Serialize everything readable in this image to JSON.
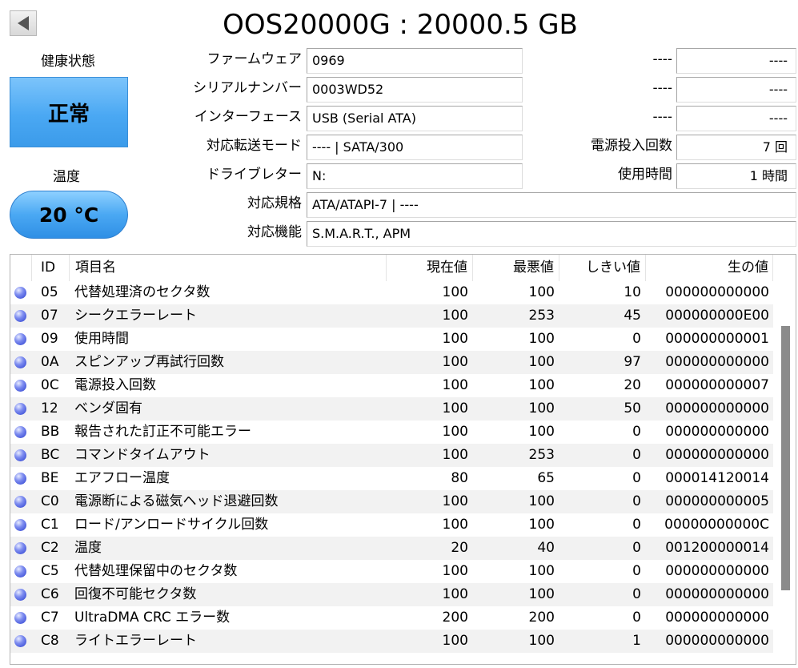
{
  "header": {
    "title": "OOS20000G : 20000.5 GB"
  },
  "health": {
    "label": "健康状態",
    "status": "正常",
    "color": "#4aa8f3"
  },
  "temperature": {
    "label": "温度",
    "value": "20 °C"
  },
  "info": {
    "firmware": {
      "label": "ファームウェア",
      "value": "0969"
    },
    "serial": {
      "label": "シリアルナンバー",
      "value": "0003WD52"
    },
    "interface": {
      "label": "インターフェース",
      "value": "USB (Serial ATA)"
    },
    "transfer_mode": {
      "label": "対応転送モード",
      "value": "---- | SATA/300"
    },
    "drive_letter": {
      "label": "ドライブレター",
      "value": "N:"
    },
    "standard": {
      "label": "対応規格",
      "value": "ATA/ATAPI-7 | ----"
    },
    "features": {
      "label": "対応機能",
      "value": "S.M.A.R.T., APM"
    }
  },
  "extra": {
    "r1": {
      "label": "----",
      "value": "----"
    },
    "r2": {
      "label": "----",
      "value": "----"
    },
    "r3": {
      "label": "----",
      "value": "----"
    },
    "power_on_count": {
      "label": "電源投入回数",
      "value": "7 回"
    },
    "power_on_hours": {
      "label": "使用時間",
      "value": "1 時間"
    }
  },
  "table": {
    "headers": {
      "id": "ID",
      "name": "項目名",
      "current": "現在値",
      "worst": "最悪値",
      "threshold": "しきい値",
      "raw": "生の値"
    },
    "rows": [
      {
        "id": "05",
        "name": "代替処理済のセクタ数",
        "current": "100",
        "worst": "100",
        "threshold": "10",
        "raw": "000000000000"
      },
      {
        "id": "07",
        "name": "シークエラーレート",
        "current": "100",
        "worst": "253",
        "threshold": "45",
        "raw": "000000000E00"
      },
      {
        "id": "09",
        "name": "使用時間",
        "current": "100",
        "worst": "100",
        "threshold": "0",
        "raw": "000000000001"
      },
      {
        "id": "0A",
        "name": "スピンアップ再試行回数",
        "current": "100",
        "worst": "100",
        "threshold": "97",
        "raw": "000000000000"
      },
      {
        "id": "0C",
        "name": "電源投入回数",
        "current": "100",
        "worst": "100",
        "threshold": "20",
        "raw": "000000000007"
      },
      {
        "id": "12",
        "name": "ベンダ固有",
        "current": "100",
        "worst": "100",
        "threshold": "50",
        "raw": "000000000000"
      },
      {
        "id": "BB",
        "name": "報告された訂正不可能エラー",
        "current": "100",
        "worst": "100",
        "threshold": "0",
        "raw": "000000000000"
      },
      {
        "id": "BC",
        "name": "コマンドタイムアウト",
        "current": "100",
        "worst": "253",
        "threshold": "0",
        "raw": "000000000000"
      },
      {
        "id": "BE",
        "name": "エアフロー温度",
        "current": "80",
        "worst": "65",
        "threshold": "0",
        "raw": "000014120014"
      },
      {
        "id": "C0",
        "name": "電源断による磁気ヘッド退避回数",
        "current": "100",
        "worst": "100",
        "threshold": "0",
        "raw": "000000000005"
      },
      {
        "id": "C1",
        "name": "ロード/アンロードサイクル回数",
        "current": "100",
        "worst": "100",
        "threshold": "0",
        "raw": "00000000000C"
      },
      {
        "id": "C2",
        "name": "温度",
        "current": "20",
        "worst": "40",
        "threshold": "0",
        "raw": "001200000014"
      },
      {
        "id": "C5",
        "name": "代替処理保留中のセクタ数",
        "current": "100",
        "worst": "100",
        "threshold": "0",
        "raw": "000000000000"
      },
      {
        "id": "C6",
        "name": "回復不可能セクタ数",
        "current": "100",
        "worst": "100",
        "threshold": "0",
        "raw": "000000000000"
      },
      {
        "id": "C7",
        "name": "UltraDMA CRC エラー数",
        "current": "200",
        "worst": "200",
        "threshold": "0",
        "raw": "000000000000"
      },
      {
        "id": "C8",
        "name": "ライトエラーレート",
        "current": "100",
        "worst": "100",
        "threshold": "1",
        "raw": "000000000000"
      }
    ]
  },
  "colors": {
    "status_dot": "#4a5ee0"
  }
}
